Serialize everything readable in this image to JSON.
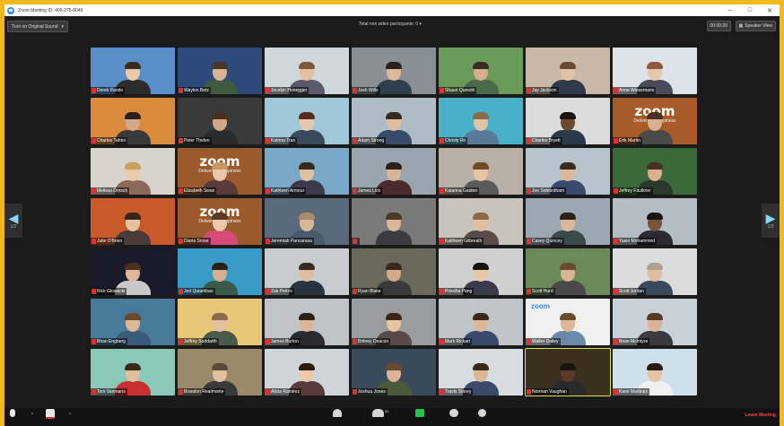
{
  "window": {
    "title": "Zoom Meeting ID: 400-275-8049"
  },
  "topbar": {
    "original_sound_label": "Turn on Original Sound",
    "participants_label": "Total non video participants: 0",
    "timer": "00:00:20",
    "speaker_view_label": "Speaker View"
  },
  "navigation": {
    "prev_page": "1/2",
    "next_page": "1/2"
  },
  "toolbar": {
    "participants_count": "52",
    "leave_label": "Leave Meeting"
  },
  "tile_logo": {
    "zoom_text": "zoom",
    "zoom_sub": "Delivering Happiness",
    "zoom_small": "zoom"
  },
  "participants": [
    {
      "name": "Derek Pando"
    },
    {
      "name": "Waylon Betz"
    },
    {
      "name": "Jocelyn Honegger"
    },
    {
      "name": "Josh Wills"
    },
    {
      "name": "Shaun Qureshi"
    },
    {
      "name": "Jay Jackson"
    },
    {
      "name": "Anne Wiesemann"
    },
    {
      "name": "Charles Tahtoi"
    },
    {
      "name": "Peter Thelen"
    },
    {
      "name": "Katrina Tran"
    },
    {
      "name": "Adam Strong"
    },
    {
      "name": "Christy Ro"
    },
    {
      "name": "Charles Bryett"
    },
    {
      "name": "Erik Martin"
    },
    {
      "name": "Melissa Dorsch"
    },
    {
      "name": "Elizabeth Swan"
    },
    {
      "name": "Kathleen Armour"
    },
    {
      "name": "James Lick"
    },
    {
      "name": "Katarina Gaiden"
    },
    {
      "name": "Joe Sidebotham"
    },
    {
      "name": "Jeffrey Faulkner"
    },
    {
      "name": "Julie O'Brien"
    },
    {
      "name": "Diana Sorse"
    },
    {
      "name": "Jeremiah Pancarasa"
    },
    {
      "name": ""
    },
    {
      "name": "Kathleen Gilbreath"
    },
    {
      "name": "Casey Quincey"
    },
    {
      "name": "Yasin Mohammed"
    },
    {
      "name": "Nick Glowacki"
    },
    {
      "name": "Jed Quiambao"
    },
    {
      "name": "Zak Peirce"
    },
    {
      "name": "Ryan Blake"
    },
    {
      "name": "Priscilla Pang"
    },
    {
      "name": "Scott Hurd"
    },
    {
      "name": "Scott Jordan"
    },
    {
      "name": "Brian Engberg"
    },
    {
      "name": "Jeffrey Suddarth"
    },
    {
      "name": "James Burton"
    },
    {
      "name": "Britney Deacon"
    },
    {
      "name": "Mark Rickart"
    },
    {
      "name": "Walter Dailey"
    },
    {
      "name": "Brian McIntyre"
    },
    {
      "name": "Tom Vanmans"
    },
    {
      "name": "Brandon Realmonte"
    },
    {
      "name": "Alicia Ramirez"
    },
    {
      "name": "Joshua Jones"
    },
    {
      "name": "Travis Storey"
    },
    {
      "name": "Norman Vaughan"
    },
    {
      "name": "Kami Martinez"
    }
  ],
  "colors": {
    "frame": "#f2b81c",
    "background": "#1b1b1b",
    "active_speaker": "#d8e04a",
    "mic_muted": "#e03030",
    "leave": "#ff4040",
    "zoom_blue": "#2d8cff"
  }
}
